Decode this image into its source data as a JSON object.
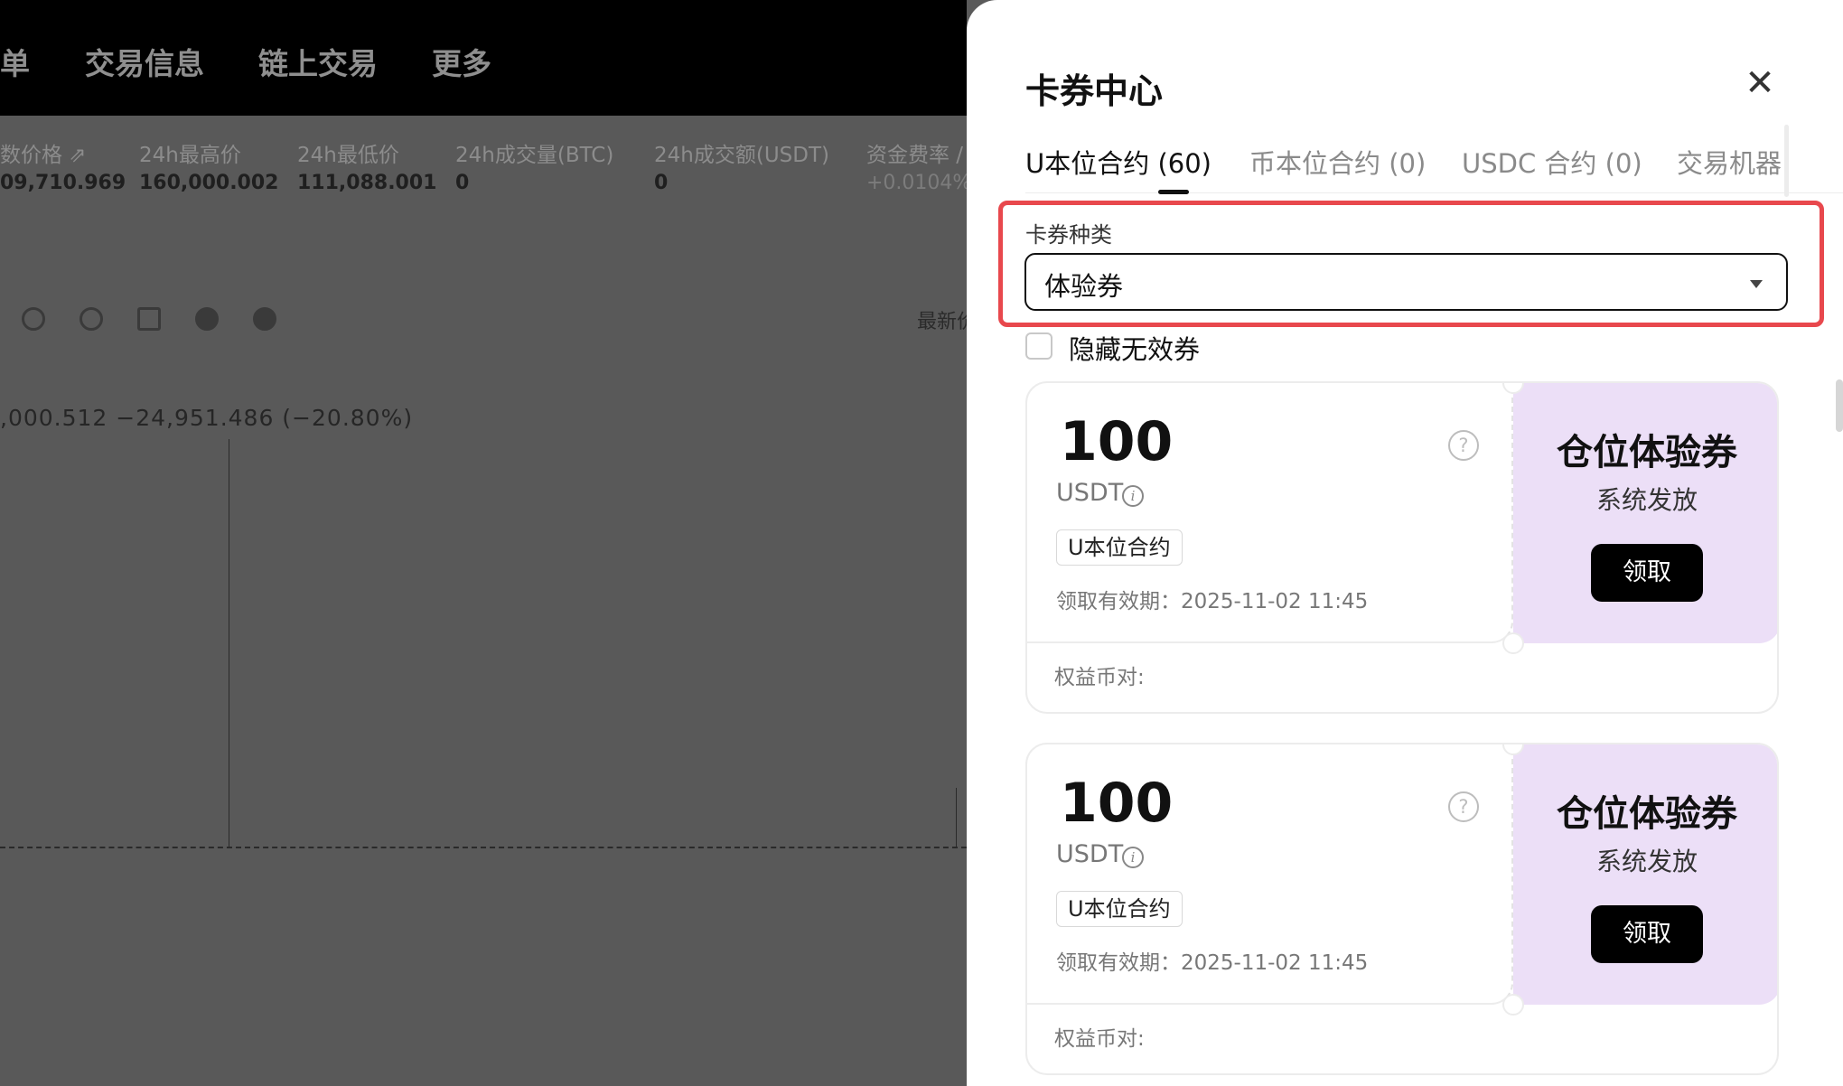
{
  "background_page": {
    "nav": [
      "单",
      "交易信息",
      "链上交易",
      "更多"
    ],
    "stats": [
      {
        "label": "数价格 ⇗",
        "value": "09,710.969"
      },
      {
        "label": "24h最高价",
        "value": "160,000.002"
      },
      {
        "label": "24h最低价",
        "value": "111,088.001"
      },
      {
        "label": "24h成交量(BTC)",
        "value": "0"
      },
      {
        "label": "24h成交额(USDT)",
        "value": "0"
      },
      {
        "label": "资金费率 /",
        "value": "+0.0104%"
      }
    ],
    "latest_label": "最新价",
    "price_change": ",000.512  −24,951.486 (−20.80%)"
  },
  "drawer": {
    "title": "卡券中心",
    "close_icon": "close-icon",
    "tabs": [
      {
        "label": "U本位合约 (60)",
        "active": true
      },
      {
        "label": "币本位合约 (0)",
        "active": false
      },
      {
        "label": "USDC 合约 (0)",
        "active": false
      },
      {
        "label": "交易机器",
        "active": false
      }
    ],
    "filter": {
      "label": "卡券种类",
      "selected": "体验券"
    },
    "hide_invalid": {
      "label": "隐藏无效券",
      "checked": false
    },
    "coupons": [
      {
        "amount": "100",
        "unit": "USDT",
        "tag": "U本位合约",
        "expiry": "领取有效期：2025-11-02 11:45",
        "type_title": "仓位体验券",
        "issuer": "系统发放",
        "claim_label": "领取",
        "pairs_label": "权益币对:"
      },
      {
        "amount": "100",
        "unit": "USDT",
        "tag": "U本位合约",
        "expiry": "领取有效期：2025-11-02 11:45",
        "type_title": "仓位体验券",
        "issuer": "系统发放",
        "claim_label": "领取",
        "pairs_label": "权益币对:"
      }
    ]
  },
  "colors": {
    "highlight": "#e8484d",
    "coupon_side": "#ecdff7",
    "overlay": "#595959"
  }
}
